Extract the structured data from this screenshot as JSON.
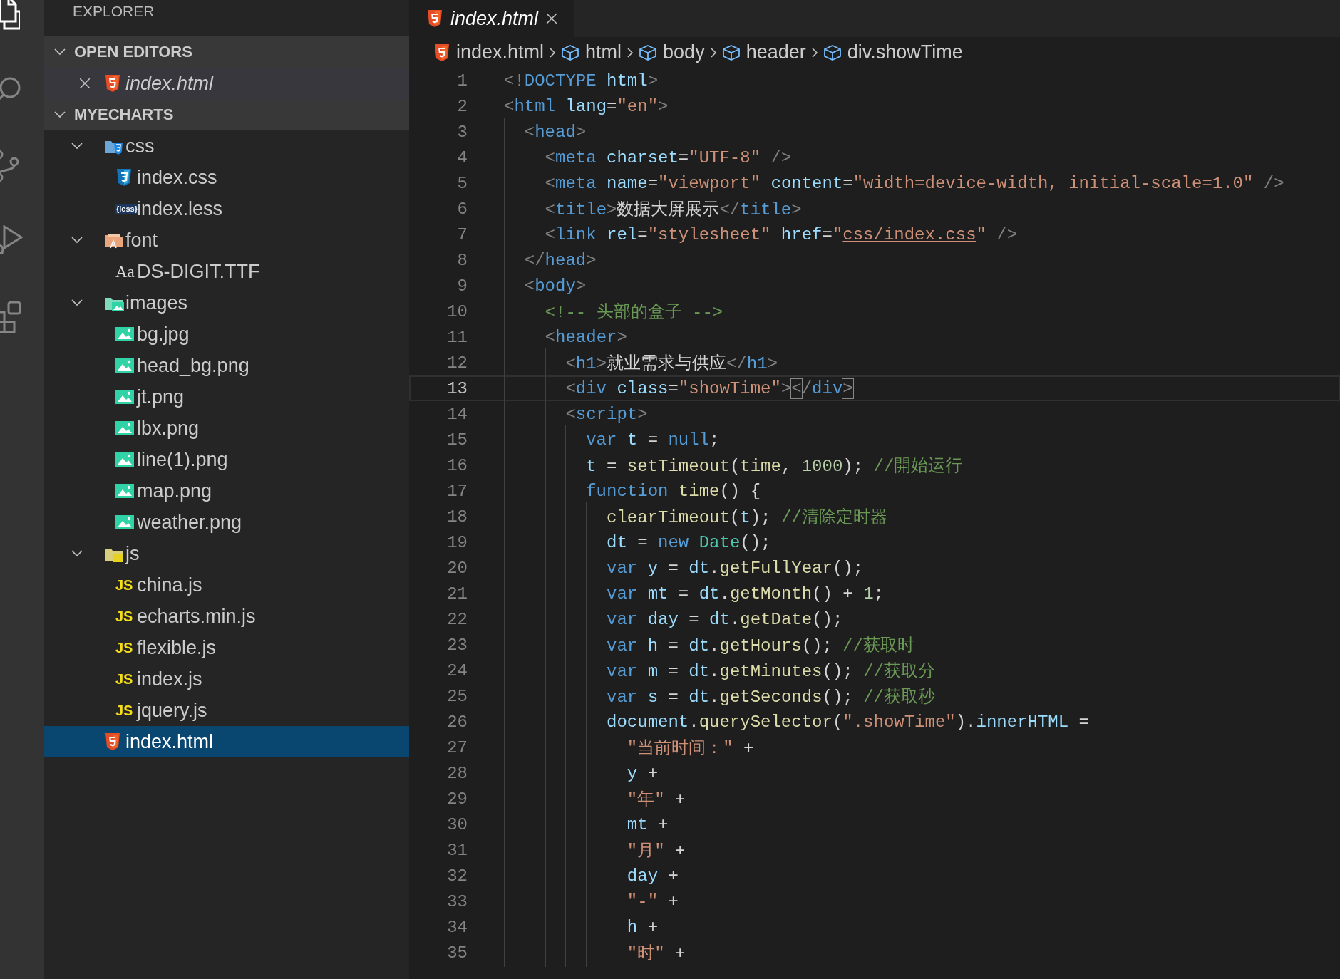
{
  "activity_bar": [
    {
      "kind": "files",
      "selected": true
    },
    {
      "kind": "search",
      "selected": false
    },
    {
      "kind": "scm",
      "selected": false
    },
    {
      "kind": "run",
      "selected": false
    },
    {
      "kind": "extensions",
      "selected": false
    }
  ],
  "explorer": {
    "title": "EXPLORER",
    "sections": [
      {
        "kind": "editors",
        "label": "OPEN EDITORS",
        "expanded": true,
        "items": [
          {
            "name": "index.html",
            "kind": "html",
            "preview": true
          }
        ]
      },
      {
        "kind": "tree",
        "label": "MYECHARTS",
        "expanded": true,
        "items": [
          {
            "kind": "cssfolder",
            "name": "css",
            "expanded": true,
            "selected": false,
            "children": [
              {
                "kind": "css",
                "name": "index.css",
                "selected": false
              },
              {
                "kind": "less",
                "name": "index.less",
                "icon": "{less}",
                "selected": false
              }
            ]
          },
          {
            "kind": "fontfolder",
            "name": "font",
            "expanded": true,
            "selected": false,
            "children": [
              {
                "kind": "font",
                "name": "DS-DIGIT.TTF",
                "icon": "Aa",
                "selected": false
              }
            ]
          },
          {
            "kind": "imagefolder",
            "name": "images",
            "expanded": true,
            "selected": false,
            "children": [
              {
                "kind": "image",
                "name": "bg.jpg",
                "selected": false
              },
              {
                "kind": "image",
                "name": "head_bg.png",
                "selected": false
              },
              {
                "kind": "image",
                "name": "jt.png",
                "selected": false
              },
              {
                "kind": "image",
                "name": "lbx.png",
                "selected": false
              },
              {
                "kind": "image",
                "name": "line(1).png",
                "selected": false
              },
              {
                "kind": "image",
                "name": "map.png",
                "selected": false
              },
              {
                "kind": "image",
                "name": "weather.png",
                "selected": false
              }
            ]
          },
          {
            "kind": "jsfolder",
            "name": "js",
            "expanded": true,
            "selected": false,
            "children": [
              {
                "kind": "js",
                "name": "china.js",
                "icon": "JS",
                "selected": false
              },
              {
                "kind": "js",
                "name": "echarts.min.js",
                "icon": "JS",
                "selected": false
              },
              {
                "kind": "js",
                "name": "flexible.js",
                "icon": "JS",
                "selected": false
              },
              {
                "kind": "js",
                "name": "index.js",
                "icon": "JS",
                "selected": false
              },
              {
                "kind": "js",
                "name": "jquery.js",
                "icon": "JS",
                "selected": false
              }
            ]
          },
          {
            "kind": "html",
            "name": "index.html",
            "selected": true
          }
        ]
      }
    ]
  },
  "tabs": [
    {
      "label": "index.html",
      "kind": "html",
      "preview": true,
      "selected": true
    }
  ],
  "breadcrumbs": [
    {
      "label": "index.html",
      "kind": "file"
    },
    {
      "label": "html",
      "kind": "element"
    },
    {
      "label": "body",
      "kind": "element"
    },
    {
      "label": "header",
      "kind": "element"
    },
    {
      "label": "div.showTime",
      "kind": "element"
    }
  ],
  "code": [
    {
      "number": "1",
      "current": false,
      "tokens": [
        {
          "kind": "punct",
          "text": "<!"
        },
        {
          "kind": "tag",
          "text": "DOCTYPE"
        },
        {
          "kind": "attr",
          "text": " html"
        },
        {
          "kind": "punct",
          "text": ">"
        }
      ]
    },
    {
      "number": "2",
      "current": false,
      "tokens": [
        {
          "kind": "punct",
          "text": "<"
        },
        {
          "kind": "tag",
          "text": "html"
        },
        {
          "kind": "attr",
          "text": " lang"
        },
        {
          "kind": "plain",
          "text": "="
        },
        {
          "kind": "string",
          "text": "\"en\""
        },
        {
          "kind": "punct",
          "text": ">"
        }
      ]
    },
    {
      "number": "3",
      "current": false,
      "tokens": [
        {
          "kind": "punct",
          "text": "  <"
        },
        {
          "kind": "tag",
          "text": "head"
        },
        {
          "kind": "punct",
          "text": ">"
        }
      ]
    },
    {
      "number": "4",
      "current": false,
      "tokens": [
        {
          "kind": "punct",
          "text": "    <"
        },
        {
          "kind": "tag",
          "text": "meta"
        },
        {
          "kind": "attr",
          "text": " charset"
        },
        {
          "kind": "plain",
          "text": "="
        },
        {
          "kind": "string",
          "text": "\"UTF-8\""
        },
        {
          "kind": "punct",
          "text": " />"
        }
      ]
    },
    {
      "number": "5",
      "current": false,
      "tokens": [
        {
          "kind": "punct",
          "text": "    <"
        },
        {
          "kind": "tag",
          "text": "meta"
        },
        {
          "kind": "attr",
          "text": " name"
        },
        {
          "kind": "plain",
          "text": "="
        },
        {
          "kind": "string",
          "text": "\"viewport\""
        },
        {
          "kind": "attr",
          "text": " content"
        },
        {
          "kind": "plain",
          "text": "="
        },
        {
          "kind": "string",
          "text": "\"width=device-width, initial-scale=1.0\""
        },
        {
          "kind": "punct",
          "text": " />"
        }
      ]
    },
    {
      "number": "6",
      "current": false,
      "tokens": [
        {
          "kind": "punct",
          "text": "    <"
        },
        {
          "kind": "tag",
          "text": "title"
        },
        {
          "kind": "punct",
          "text": ">"
        },
        {
          "kind": "plain",
          "text": "数据大屏展示"
        },
        {
          "kind": "punct",
          "text": "</"
        },
        {
          "kind": "tag",
          "text": "title"
        },
        {
          "kind": "punct",
          "text": ">"
        }
      ]
    },
    {
      "number": "7",
      "current": false,
      "tokens": [
        {
          "kind": "punct",
          "text": "    <"
        },
        {
          "kind": "tag",
          "text": "link"
        },
        {
          "kind": "attr",
          "text": " rel"
        },
        {
          "kind": "plain",
          "text": "="
        },
        {
          "kind": "string",
          "text": "\"stylesheet\""
        },
        {
          "kind": "attr",
          "text": " href"
        },
        {
          "kind": "plain",
          "text": "="
        },
        {
          "kind": "string",
          "text": "\""
        },
        {
          "kind": "link",
          "text": "css/index.css"
        },
        {
          "kind": "string",
          "text": "\""
        },
        {
          "kind": "punct",
          "text": " />"
        }
      ]
    },
    {
      "number": "8",
      "current": false,
      "tokens": [
        {
          "kind": "punct",
          "text": "  </"
        },
        {
          "kind": "tag",
          "text": "head"
        },
        {
          "kind": "punct",
          "text": ">"
        }
      ]
    },
    {
      "number": "9",
      "current": false,
      "tokens": [
        {
          "kind": "punct",
          "text": "  <"
        },
        {
          "kind": "tag",
          "text": "body"
        },
        {
          "kind": "punct",
          "text": ">"
        }
      ]
    },
    {
      "number": "10",
      "current": false,
      "tokens": [
        {
          "kind": "comment",
          "text": "    <!-- 头部的盒子 -->"
        }
      ]
    },
    {
      "number": "11",
      "current": false,
      "tokens": [
        {
          "kind": "punct",
          "text": "    <"
        },
        {
          "kind": "tag",
          "text": "header"
        },
        {
          "kind": "punct",
          "text": ">"
        }
      ]
    },
    {
      "number": "12",
      "current": false,
      "tokens": [
        {
          "kind": "punct",
          "text": "      <"
        },
        {
          "kind": "tag",
          "text": "h1"
        },
        {
          "kind": "punct",
          "text": ">"
        },
        {
          "kind": "plain",
          "text": "就业需求与供应"
        },
        {
          "kind": "punct",
          "text": "</"
        },
        {
          "kind": "tag",
          "text": "h1"
        },
        {
          "kind": "punct",
          "text": ">"
        }
      ]
    },
    {
      "number": "13",
      "current": true,
      "tokens": [
        {
          "kind": "punct",
          "text": "      <"
        },
        {
          "kind": "tag",
          "text": "div"
        },
        {
          "kind": "attr",
          "text": " class"
        },
        {
          "kind": "plain",
          "text": "="
        },
        {
          "kind": "string",
          "text": "\"showTime\""
        },
        {
          "kind": "punct",
          "text": ">"
        },
        {
          "kind": "match",
          "text": "<"
        },
        {
          "kind": "punct",
          "text": "/"
        },
        {
          "kind": "tag",
          "text": "div"
        },
        {
          "kind": "match",
          "text": ">"
        }
      ]
    },
    {
      "number": "14",
      "current": false,
      "tokens": [
        {
          "kind": "punct",
          "text": "      <"
        },
        {
          "kind": "tag",
          "text": "script"
        },
        {
          "kind": "punct",
          "text": ">"
        }
      ]
    },
    {
      "number": "15",
      "current": false,
      "tokens": [
        {
          "kind": "keyword",
          "text": "        var"
        },
        {
          "kind": "variable",
          "text": " t"
        },
        {
          "kind": "plain",
          "text": " = "
        },
        {
          "kind": "keyword",
          "text": "null"
        },
        {
          "kind": "plain",
          "text": ";"
        }
      ]
    },
    {
      "number": "16",
      "current": false,
      "tokens": [
        {
          "kind": "variable",
          "text": "        t"
        },
        {
          "kind": "plain",
          "text": " = "
        },
        {
          "kind": "function",
          "text": "setTimeout"
        },
        {
          "kind": "plain",
          "text": "("
        },
        {
          "kind": "function",
          "text": "time"
        },
        {
          "kind": "plain",
          "text": ", "
        },
        {
          "kind": "number",
          "text": "1000"
        },
        {
          "kind": "plain",
          "text": "); "
        },
        {
          "kind": "comment",
          "text": "//開始运行"
        }
      ]
    },
    {
      "number": "17",
      "current": false,
      "tokens": [
        {
          "kind": "keyword",
          "text": "        function"
        },
        {
          "kind": "function",
          "text": " time"
        },
        {
          "kind": "plain",
          "text": "() {"
        }
      ]
    },
    {
      "number": "18",
      "current": false,
      "tokens": [
        {
          "kind": "function",
          "text": "          clearTimeout"
        },
        {
          "kind": "plain",
          "text": "("
        },
        {
          "kind": "variable",
          "text": "t"
        },
        {
          "kind": "plain",
          "text": "); "
        },
        {
          "kind": "comment",
          "text": "//清除定时器"
        }
      ]
    },
    {
      "number": "19",
      "current": false,
      "tokens": [
        {
          "kind": "variable",
          "text": "          dt"
        },
        {
          "kind": "plain",
          "text": " = "
        },
        {
          "kind": "keyword",
          "text": "new"
        },
        {
          "kind": "type",
          "text": " Date"
        },
        {
          "kind": "plain",
          "text": "();"
        }
      ]
    },
    {
      "number": "20",
      "current": false,
      "tokens": [
        {
          "kind": "keyword",
          "text": "          var"
        },
        {
          "kind": "variable",
          "text": " y"
        },
        {
          "kind": "plain",
          "text": " = "
        },
        {
          "kind": "variable",
          "text": "dt"
        },
        {
          "kind": "plain",
          "text": "."
        },
        {
          "kind": "function",
          "text": "getFullYear"
        },
        {
          "kind": "plain",
          "text": "();"
        }
      ]
    },
    {
      "number": "21",
      "current": false,
      "tokens": [
        {
          "kind": "keyword",
          "text": "          var"
        },
        {
          "kind": "variable",
          "text": " mt"
        },
        {
          "kind": "plain",
          "text": " = "
        },
        {
          "kind": "variable",
          "text": "dt"
        },
        {
          "kind": "plain",
          "text": "."
        },
        {
          "kind": "function",
          "text": "getMonth"
        },
        {
          "kind": "plain",
          "text": "() + "
        },
        {
          "kind": "number",
          "text": "1"
        },
        {
          "kind": "plain",
          "text": ";"
        }
      ]
    },
    {
      "number": "22",
      "current": false,
      "tokens": [
        {
          "kind": "keyword",
          "text": "          var"
        },
        {
          "kind": "variable",
          "text": " day"
        },
        {
          "kind": "plain",
          "text": " = "
        },
        {
          "kind": "variable",
          "text": "dt"
        },
        {
          "kind": "plain",
          "text": "."
        },
        {
          "kind": "function",
          "text": "getDate"
        },
        {
          "kind": "plain",
          "text": "();"
        }
      ]
    },
    {
      "number": "23",
      "current": false,
      "tokens": [
        {
          "kind": "keyword",
          "text": "          var"
        },
        {
          "kind": "variable",
          "text": " h"
        },
        {
          "kind": "plain",
          "text": " = "
        },
        {
          "kind": "variable",
          "text": "dt"
        },
        {
          "kind": "plain",
          "text": "."
        },
        {
          "kind": "function",
          "text": "getHours"
        },
        {
          "kind": "plain",
          "text": "(); "
        },
        {
          "kind": "comment",
          "text": "//获取时"
        }
      ]
    },
    {
      "number": "24",
      "current": false,
      "tokens": [
        {
          "kind": "keyword",
          "text": "          var"
        },
        {
          "kind": "variable",
          "text": " m"
        },
        {
          "kind": "plain",
          "text": " = "
        },
        {
          "kind": "variable",
          "text": "dt"
        },
        {
          "kind": "plain",
          "text": "."
        },
        {
          "kind": "function",
          "text": "getMinutes"
        },
        {
          "kind": "plain",
          "text": "(); "
        },
        {
          "kind": "comment",
          "text": "//获取分"
        }
      ]
    },
    {
      "number": "25",
      "current": false,
      "tokens": [
        {
          "kind": "keyword",
          "text": "          var"
        },
        {
          "kind": "variable",
          "text": " s"
        },
        {
          "kind": "plain",
          "text": " = "
        },
        {
          "kind": "variable",
          "text": "dt"
        },
        {
          "kind": "plain",
          "text": "."
        },
        {
          "kind": "function",
          "text": "getSeconds"
        },
        {
          "kind": "plain",
          "text": "(); "
        },
        {
          "kind": "comment",
          "text": "//获取秒"
        }
      ]
    },
    {
      "number": "26",
      "current": false,
      "tokens": [
        {
          "kind": "variable",
          "text": "          document"
        },
        {
          "kind": "plain",
          "text": "."
        },
        {
          "kind": "function",
          "text": "querySelector"
        },
        {
          "kind": "plain",
          "text": "("
        },
        {
          "kind": "string",
          "text": "\".showTime\""
        },
        {
          "kind": "plain",
          "text": ")."
        },
        {
          "kind": "variable",
          "text": "innerHTML"
        },
        {
          "kind": "plain",
          "text": " ="
        }
      ]
    },
    {
      "number": "27",
      "current": false,
      "tokens": [
        {
          "kind": "string",
          "text": "            \"当前时间：\""
        },
        {
          "kind": "plain",
          "text": " +"
        }
      ]
    },
    {
      "number": "28",
      "current": false,
      "tokens": [
        {
          "kind": "variable",
          "text": "            y"
        },
        {
          "kind": "plain",
          "text": " +"
        }
      ]
    },
    {
      "number": "29",
      "current": false,
      "tokens": [
        {
          "kind": "string",
          "text": "            \"年\""
        },
        {
          "kind": "plain",
          "text": " +"
        }
      ]
    },
    {
      "number": "30",
      "current": false,
      "tokens": [
        {
          "kind": "variable",
          "text": "            mt"
        },
        {
          "kind": "plain",
          "text": " +"
        }
      ]
    },
    {
      "number": "31",
      "current": false,
      "tokens": [
        {
          "kind": "string",
          "text": "            \"月\""
        },
        {
          "kind": "plain",
          "text": " +"
        }
      ]
    },
    {
      "number": "32",
      "current": false,
      "tokens": [
        {
          "kind": "variable",
          "text": "            day"
        },
        {
          "kind": "plain",
          "text": " +"
        }
      ]
    },
    {
      "number": "33",
      "current": false,
      "tokens": [
        {
          "kind": "string",
          "text": "            \"-\""
        },
        {
          "kind": "plain",
          "text": " +"
        }
      ]
    },
    {
      "number": "34",
      "current": false,
      "tokens": [
        {
          "kind": "variable",
          "text": "            h"
        },
        {
          "kind": "plain",
          "text": " +"
        }
      ]
    },
    {
      "number": "35",
      "current": false,
      "tokens": [
        {
          "kind": "string",
          "text": "            \"时\""
        },
        {
          "kind": "plain",
          "text": " +"
        }
      ]
    }
  ]
}
